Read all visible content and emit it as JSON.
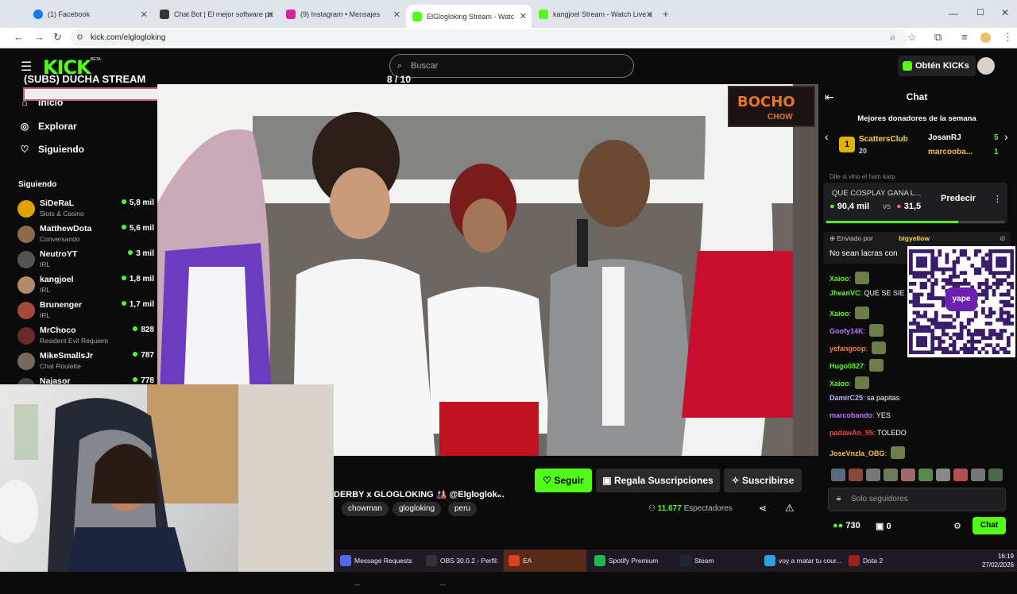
{
  "browser": {
    "tabs": [
      {
        "title": "(1) Facebook",
        "color": "#1877f2"
      },
      {
        "title": "Chat Bot | El mejor software pa",
        "color": "#333333"
      },
      {
        "title": "(9) Instagram • Mensajes",
        "color": "#d6249f"
      },
      {
        "title": "ElGlogloking Stream - Watc",
        "color": "#53fc18"
      },
      {
        "title": "kangjoel Stream - Watch Live o",
        "color": "#53fc18"
      }
    ],
    "new_tab": "+",
    "url": "kick.com/elglogloking"
  },
  "header": {
    "logo": "KICK",
    "logo_beta": "BETA",
    "search_placeholder": "Buscar",
    "kicks_button": "Obtén KICKs"
  },
  "overlay": {
    "title": "(SUBS) DUCHA STREAM",
    "counter": "8 / 10",
    "progress": 0.8
  },
  "sidebar": {
    "nav": [
      {
        "label": "Inicio",
        "icon": "home-icon"
      },
      {
        "label": "Explorar",
        "icon": "compass-icon"
      },
      {
        "label": "Siguiendo",
        "icon": "heart-icon"
      }
    ],
    "section_title": "Siguiendo",
    "channels": [
      {
        "name": "SiDeRaL",
        "category": "Slots & Casino",
        "viewers": "5,8 mil",
        "color": "#e0a000"
      },
      {
        "name": "MatthewDota",
        "category": "Conversando",
        "viewers": "5,6 mil",
        "color": "#8b6b4a"
      },
      {
        "name": "NeutroYT",
        "category": "IRL",
        "viewers": "3 mil",
        "color": "#555555"
      },
      {
        "name": "kangjoel",
        "category": "IRL",
        "viewers": "1,8 mil",
        "color": "#b48a6a"
      },
      {
        "name": "Brunenger",
        "category": "IRL",
        "viewers": "1,7 mil",
        "color": "#a44a3a"
      },
      {
        "name": "MrChoco",
        "category": "Resident Evil Requiem",
        "viewers": "828",
        "color": "#6a2a2a"
      },
      {
        "name": "MikeSmallsJr",
        "category": "Chat Roulette",
        "viewers": "787",
        "color": "#7a6a5a"
      },
      {
        "name": "Najasor",
        "category": "",
        "viewers": "778",
        "color": "#444444"
      }
    ]
  },
  "video_overlay": {
    "brand": "BOCHO",
    "brand_sub": "CHOW"
  },
  "stream": {
    "title": "DERBY x GLOGLOKING 🎎 @Elgloglok...",
    "tags": [
      "chowman",
      "glogloking",
      "peru"
    ],
    "follow": "Seguir",
    "gift": "Regala Suscripciones",
    "subscribe": "Suscribirse",
    "viewers": "11.677",
    "viewers_label": "Espectadores"
  },
  "chat": {
    "title": "Chat",
    "donors_title": "Mejores donadores de la semana",
    "donors": [
      {
        "rank": "1",
        "name": "ScattersClub",
        "amount": "20"
      },
      {
        "name": "JosanRJ",
        "amount": "5"
      },
      {
        "name": "marcooba...",
        "amount": "1"
      }
    ],
    "prediction": {
      "question": "QUE COSPLAY GANA L...",
      "left": "90,4 mil",
      "vs": "vs",
      "right": "31,5",
      "button": "Predecir",
      "fill": 0.74
    },
    "pinned_by_label": "Enviado por",
    "pinned_by": "bigyellow",
    "pinned_msg": "No sean lacras con",
    "partial_msg": "Dile si vino el ham karp",
    "messages": [
      {
        "user": "Xaioo",
        "text": "",
        "color": "#53fc18"
      },
      {
        "user": "JheanVC",
        "text": "QUE SE SIE",
        "color": "#53fc18"
      },
      {
        "user": "Xaioo",
        "text": "",
        "color": "#53fc18"
      },
      {
        "user": "Goofy14K",
        "text": "",
        "color": "#c070ff"
      },
      {
        "user": "yefangoop",
        "text": "",
        "color": "#ff7a3a"
      },
      {
        "user": "Hugo0827",
        "text": "",
        "color": "#53fc18"
      },
      {
        "user": "Xaioo",
        "text": "",
        "color": "#53fc18"
      },
      {
        "user": "DamirC25",
        "text": "sa papitas",
        "color": "#b8b8ff"
      },
      {
        "user": "marcobando",
        "text": "YES",
        "color": "#c070ff"
      },
      {
        "user": "padawAn_95",
        "text": "TOLEDO",
        "color": "#ff3a3a"
      },
      {
        "user": "JoseVnzla_OBG",
        "text": "",
        "color": "#ffb84a"
      }
    ],
    "input_placeholder": "Solo seguidores",
    "points": "730",
    "gift_count": "0",
    "send": "Chat",
    "qr_label": "yape"
  },
  "taskbar": {
    "items": [
      {
        "label": "Message Requests ...",
        "color": "#5865f2"
      },
      {
        "label": "OBS 30.0.2 - Perfil: ...",
        "color": "#333333"
      },
      {
        "label": "EA",
        "color": "#e04020"
      },
      {
        "label": "Spotify Premium",
        "color": "#1db954"
      },
      {
        "label": "Steam",
        "color": "#1b2838"
      },
      {
        "label": "voy a matar tu cour...",
        "color": "#2aa3e0"
      },
      {
        "label": "Dota 2",
        "color": "#a02020"
      }
    ],
    "time": "16:19",
    "date": "27/02/2026"
  }
}
